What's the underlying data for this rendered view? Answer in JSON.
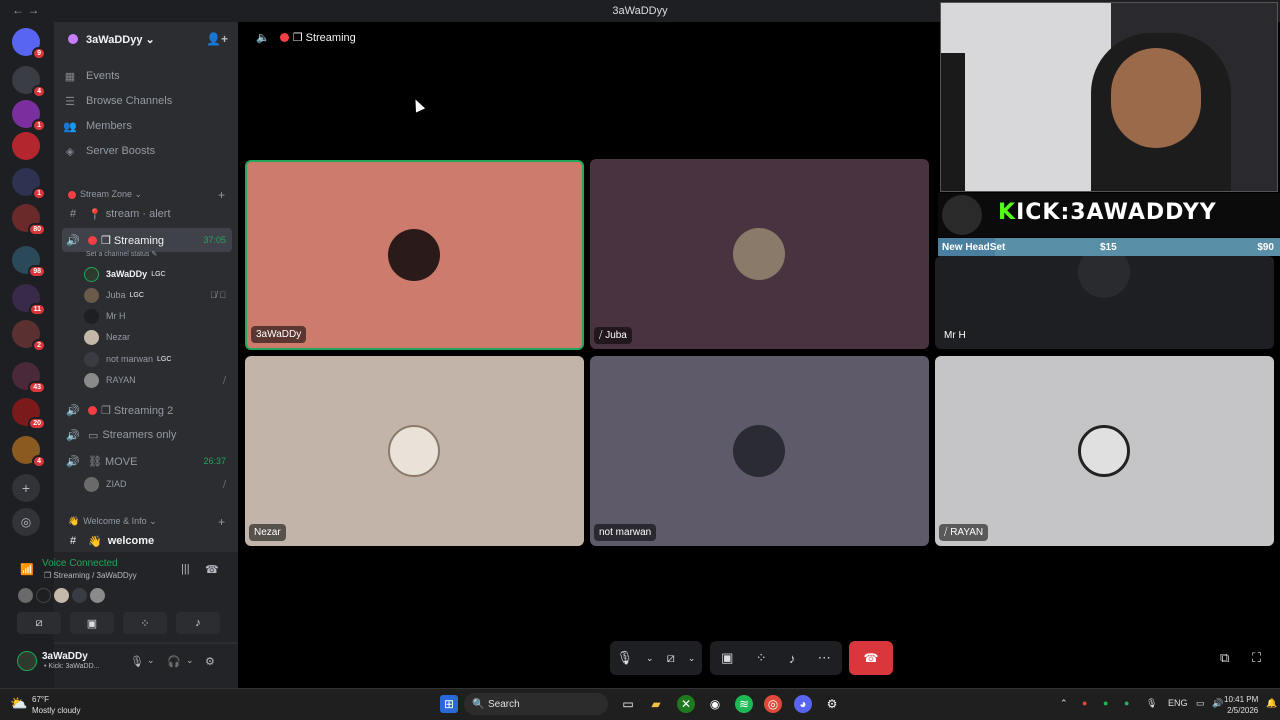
{
  "window": {
    "title": "3aWaDDyy"
  },
  "guild_badges": [
    "9",
    "4",
    "1",
    "1",
    "1",
    "80",
    "98",
    "11",
    "2",
    "43",
    "20",
    "4"
  ],
  "server": {
    "name": "3aWaDDyy ⌄"
  },
  "nav_items": [
    {
      "label": "Events",
      "icon": "calendar-icon"
    },
    {
      "label": "Browse Channels",
      "icon": "list-icon"
    },
    {
      "label": "Members",
      "icon": "members-icon"
    },
    {
      "label": "Server Boosts",
      "icon": "boost-icon"
    }
  ],
  "categories": {
    "stream_zone": "Stream Zone ⌄",
    "welcome_info": "Welcome & Info ⌄"
  },
  "channels": {
    "stream_alert": "stream · alert",
    "streaming": "❒ Streaming",
    "streaming_time": "37:05",
    "set_status": "Set a channel status ✎",
    "streaming2": "❒ Streaming 2",
    "streamers_only": "Streamers only",
    "move": "⛓ MOVE",
    "move_time": "26:37",
    "welcome": "welcome"
  },
  "voice_users": [
    {
      "name": "3aWaDDy",
      "tag": "LGC"
    },
    {
      "name": "Juba",
      "tag": "LGC"
    },
    {
      "name": "Mr H",
      "tag": ""
    },
    {
      "name": "Nezar",
      "tag": ""
    },
    {
      "name": "not marwan",
      "tag": "LGC"
    },
    {
      "name": "RAYAN",
      "tag": ""
    }
  ],
  "move_users": [
    {
      "name": "ZIAD"
    }
  ],
  "voice_panel": {
    "title": "Voice Connected",
    "subtitle": "❒ Streaming / 3aWaDDyy"
  },
  "user_bar": {
    "name": "3aWaDDy",
    "status": "• Kick: 3aWaDD..."
  },
  "stage": {
    "channel": "❒ Streaming"
  },
  "tiles": [
    {
      "name": "3aWaDDy",
      "color": "#cd7b6d"
    },
    {
      "name": "Juba",
      "color": "#4a3340"
    },
    {
      "name": "Mr H",
      "color": "#1e1f22"
    },
    {
      "name": "Nezar",
      "color": "#c2b4a9"
    },
    {
      "name": "not marwan",
      "color": "#5e5a6a"
    },
    {
      "name": "RAYAN",
      "color": "#c5c5c8"
    }
  ],
  "overlay": {
    "kick_k": "K",
    "kick_rest": "ICK:3AWADDYY",
    "goal_label": "New HeadSet",
    "goal_current": "$15",
    "goal_target": "$90"
  },
  "taskbar": {
    "search": "Search",
    "weather_temp": "67°F",
    "weather_desc": "Mostly cloudy",
    "lang": "ENG",
    "time": "10:41 PM",
    "date": "2/5/2026"
  },
  "colors": {
    "accent_green": "#23a55a",
    "hangup_red": "#da373c",
    "kick_green": "#53fc18"
  }
}
